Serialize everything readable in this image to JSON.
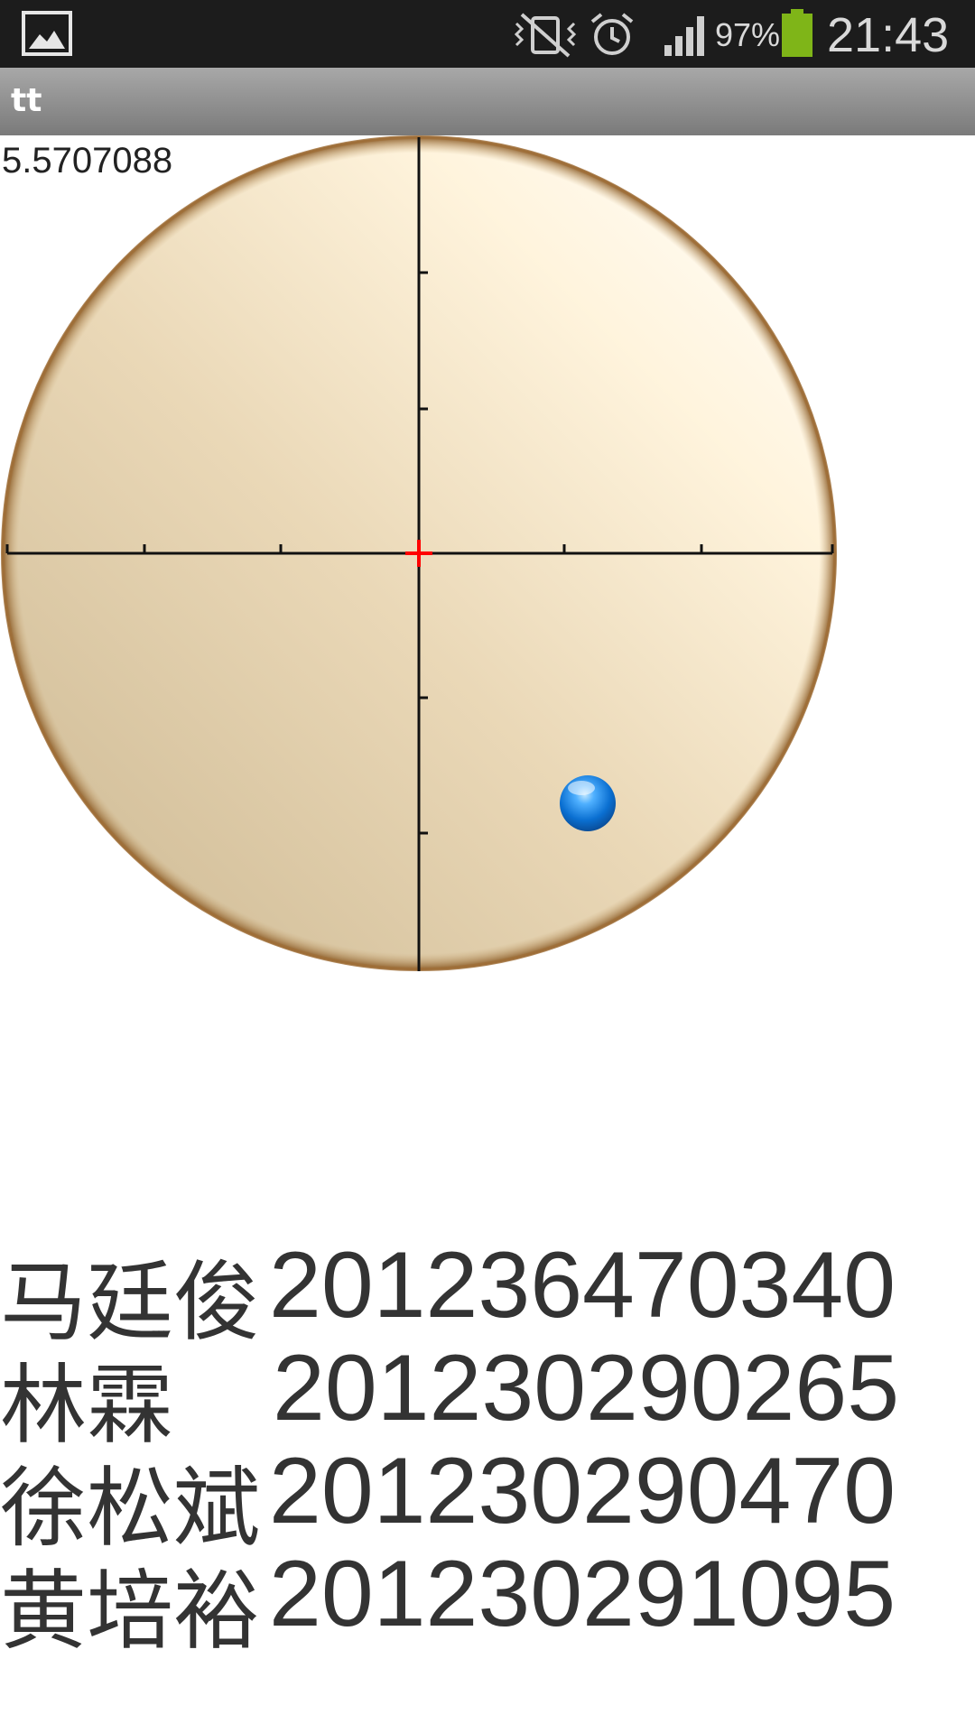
{
  "status_bar": {
    "icons": [
      "gallery-icon",
      "vibrate-off-icon",
      "alarm-icon",
      "signal-icon",
      "battery-icon"
    ],
    "battery_percent": "97%",
    "battery_level": 0.97,
    "time": "21:43"
  },
  "app_bar": {
    "title": "tt"
  },
  "level": {
    "readout": "5.5707088",
    "bubble_icon": "blue-ball-icon",
    "center_marker_color": "#ff0000",
    "bubble_color": "#1a7fd6",
    "rim_color": "#a0703a"
  },
  "credits": [
    {
      "name": "马廷俊",
      "id": "201236470340"
    },
    {
      "name": "林霖",
      "id": "201230290265"
    },
    {
      "name": "徐松斌",
      "id": "201230290470"
    },
    {
      "name": "黄培裕",
      "id": "201230291095"
    }
  ]
}
